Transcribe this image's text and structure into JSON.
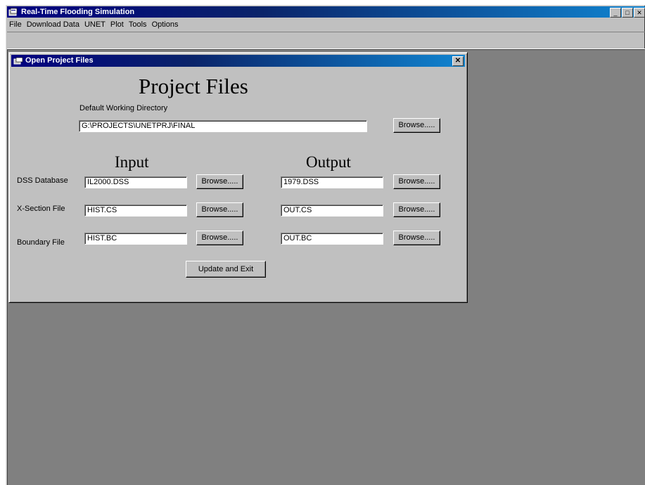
{
  "app": {
    "title": "Real-Time Flooding Simulation",
    "menu": [
      "File",
      "Download Data",
      "UNET",
      "Plot",
      "Tools",
      "Options"
    ],
    "window_buttons": {
      "minimize": "_",
      "maximize": "□",
      "close": "✕"
    }
  },
  "dialog": {
    "title": "Open Project Files",
    "close": "✕",
    "heading": "Project Files",
    "working_dir_label": "Default Working Directory",
    "working_dir_value": "G:\\PROJECTS\\UNETPRJ\\FINAL",
    "browse_label": "Browse.....",
    "input_heading": "Input",
    "output_heading": "Output",
    "rows": [
      {
        "label": "DSS Database",
        "input": "IL2000.DSS",
        "output": "1979.DSS"
      },
      {
        "label": "X-Section  File",
        "input": "HIST.CS",
        "output": "OUT.CS"
      },
      {
        "label": "Boundary File",
        "input": "HIST.BC",
        "output": "OUT.BC"
      }
    ],
    "update_button": "Update and Exit"
  },
  "colors": {
    "titlebar": "#000080",
    "face": "#c0c0c0",
    "mdi_background": "#808080"
  }
}
